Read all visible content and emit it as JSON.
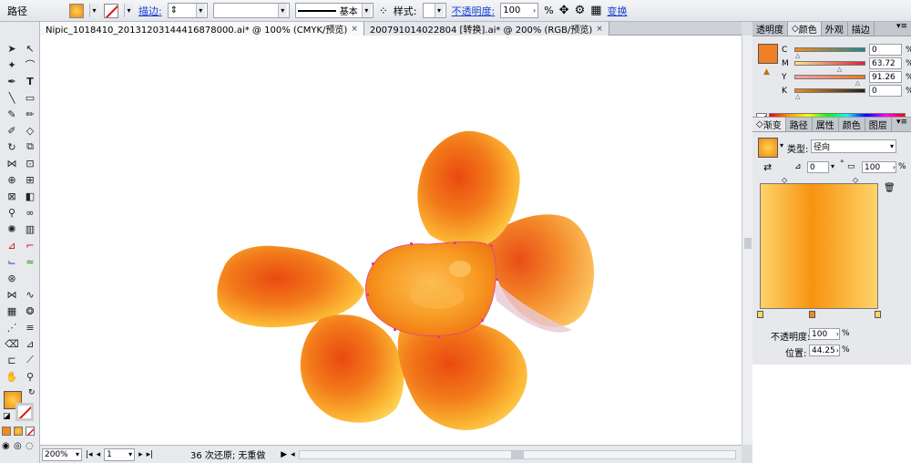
{
  "control_bar": {
    "object_type": "路径",
    "stroke_label": "描边:",
    "stroke_style": "基本",
    "style_label": "样式:",
    "opacity_label": "不透明度:",
    "opacity_value": "100",
    "opacity_unit": "%",
    "transform_label": "变换"
  },
  "tabs": [
    {
      "label": "Nipic_1018410_20131203144416878000.ai* @ 100% (CMYK/预览)",
      "close": "×"
    },
    {
      "label": "200791014022804  [转换].ai* @ 200% (RGB/预览)",
      "close": "×"
    }
  ],
  "status": {
    "zoom": "200%",
    "page": "1",
    "info": "36 次还原; 无重做"
  },
  "color_panel": {
    "tabs": [
      "透明度",
      "颜色",
      "外观",
      "描边"
    ],
    "active_tab": 1,
    "fill_color": "#ef7f22",
    "channels": [
      {
        "name": "C",
        "value": "0",
        "pct": 0
      },
      {
        "name": "M",
        "value": "63.72",
        "pct": 63.72
      },
      {
        "name": "Y",
        "value": "91.26",
        "pct": 91.26
      },
      {
        "name": "K",
        "value": "0",
        "pct": 0
      }
    ],
    "unit": "%"
  },
  "gradient_panel": {
    "tabs": [
      "渐变",
      "路径",
      "属性",
      "颜色",
      "图层"
    ],
    "type_label": "类型:",
    "type_value": "径向",
    "angle_value": "0",
    "angle_unit": "°",
    "aspect_value": "100",
    "aspect_unit": "%",
    "opacity_label": "不透明度:",
    "opacity_value": "100",
    "location_label": "位置:",
    "location_value": "44.25",
    "pct": "%"
  },
  "colors": {
    "accent_orange": "#f08a1a",
    "gradient_left": "#fdd46a",
    "gradient_mid": "#f7930f",
    "gradient_right": "#fdd46a"
  }
}
